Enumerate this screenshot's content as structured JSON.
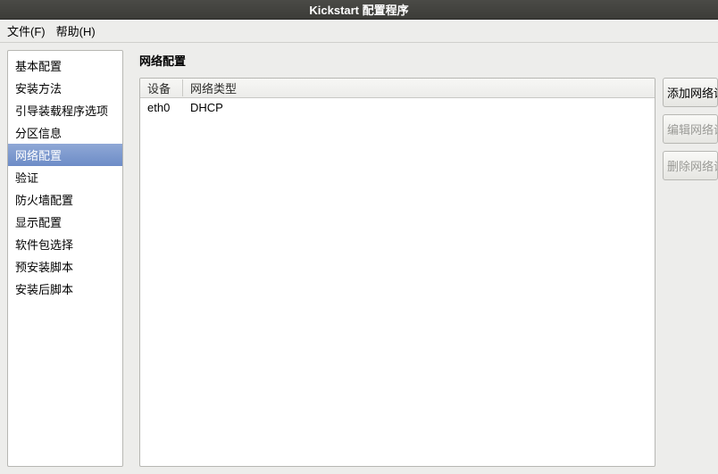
{
  "window": {
    "title": "Kickstart 配置程序"
  },
  "menubar": {
    "file": "文件(F)",
    "help": "帮助(H)"
  },
  "sidebar": {
    "items": [
      {
        "label": "基本配置"
      },
      {
        "label": "安装方法"
      },
      {
        "label": "引导装载程序选项"
      },
      {
        "label": "分区信息"
      },
      {
        "label": "网络配置"
      },
      {
        "label": "验证"
      },
      {
        "label": "防火墙配置"
      },
      {
        "label": "显示配置"
      },
      {
        "label": "软件包选择"
      },
      {
        "label": "预安装脚本"
      },
      {
        "label": "安装后脚本"
      }
    ],
    "selected_index": 4
  },
  "main": {
    "title": "网络配置",
    "columns": {
      "device": "设备",
      "type": "网络类型"
    },
    "rows": [
      {
        "device": "eth0",
        "type": "DHCP"
      }
    ],
    "buttons": {
      "add": "添加网络设备",
      "edit": "编辑网络设备",
      "delete": "删除网络设备"
    }
  }
}
